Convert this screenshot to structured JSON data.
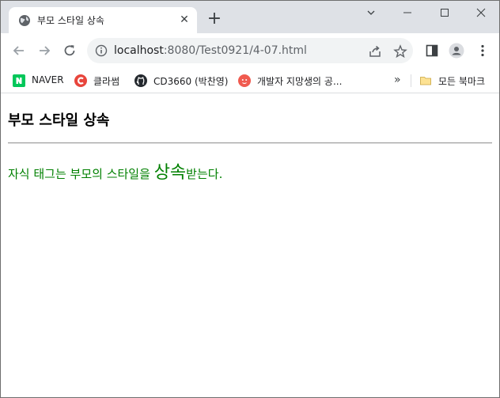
{
  "tab": {
    "title": "부모 스타일 상속",
    "close": "✕",
    "new_tab": "+"
  },
  "omnibox": {
    "url_host": "localhost",
    "url_rest": ":8080/Test0921/4-07.html"
  },
  "bookmarks": [
    {
      "label": "NAVER",
      "icon": "naver-icon",
      "color": "#03c75a"
    },
    {
      "label": "클라썸",
      "icon": "classum-icon",
      "color": "#e8453c"
    },
    {
      "label": "CD3660 (박찬영)",
      "icon": "github-icon",
      "color": "#24292e"
    },
    {
      "label": "개발자 지망생의 공...",
      "icon": "blog-icon",
      "color": "#f05a4f"
    }
  ],
  "bookmarks_more": "»",
  "bookmarks_folder": {
    "label": "모든 북마크",
    "icon": "folder-icon"
  },
  "page": {
    "heading": "부모 스타일 상속",
    "para_before": "자식 태그는 부모의 스타일을 ",
    "para_big": "상속",
    "para_after": "받는다.",
    "text_color": "#008000"
  },
  "colors": {
    "titlebar": "#dee1e6",
    "omnibox": "#f1f3f4"
  }
}
